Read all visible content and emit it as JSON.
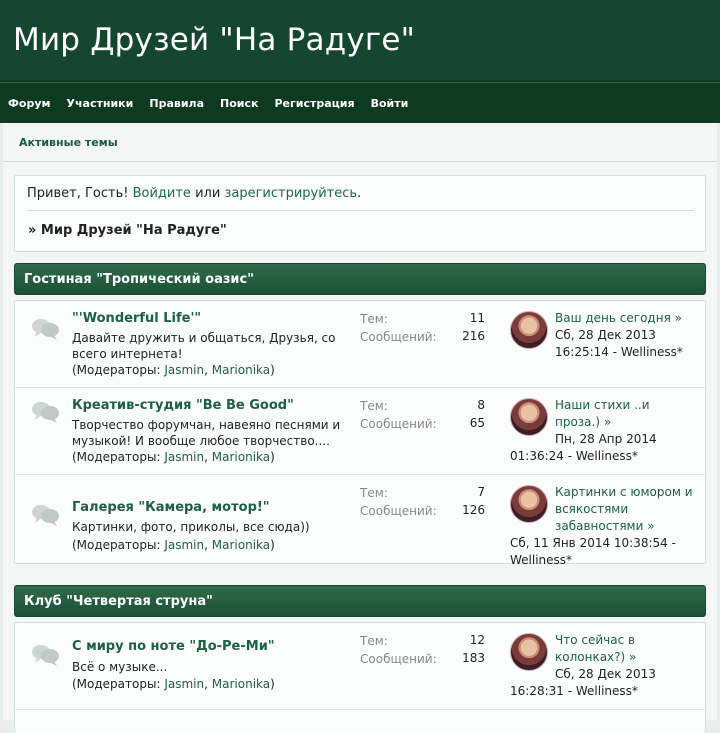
{
  "site": {
    "title": "Мир Друзей \"На Радуге\""
  },
  "menu": [
    "Форум",
    "Участники",
    "Правила",
    "Поиск",
    "Регистрация",
    "Войти"
  ],
  "subbar": {
    "active_topics": "Активные темы"
  },
  "userbox": {
    "greeting_prefix": "Привет, Гость!",
    "login_link": "Войдите",
    "or": "или",
    "register_link": "зарегистрируйтесь",
    "period": ".",
    "breadcrumb": "» Мир Друзей \"На Радуге\""
  },
  "labels": {
    "topics": "Тем:",
    "posts": "Сообщений:",
    "moderators_prefix": "(Модераторы:",
    "moderators_suffix": ")",
    "comma": ","
  },
  "categories": [
    {
      "name": "Гостиная \"Тропический оазис\"",
      "boards": [
        {
          "name": "\"'Wonderful Life'\"",
          "description": "Давайте дружить и общаться, Друзья, со всего интернета!",
          "moderators": [
            "Jasmin",
            "Marionika"
          ],
          "topics": "11",
          "posts": "216",
          "last_post_title": "Ваш день сегодня »",
          "last_post_date": "Сб, 28 Дек 2013",
          "last_post_time_author": "16:25:14 - Welliness*"
        },
        {
          "name": "Креатив-студия \"Be Be Good\"",
          "description": "Творчество форумчан, навеяно песнями и музыкой! И вообще любое творчество....",
          "moderators": [
            "Jasmin",
            "Marionika"
          ],
          "topics": "8",
          "posts": "65",
          "last_post_title": "Наши стихи ..и проза.) »",
          "last_post_date": "Пн, 28 Апр 2014",
          "last_post_time_author": "01:36:24 - Welliness*"
        },
        {
          "name": "Галерея \"Камера, мотор!\"",
          "description": "Картинки, фото, приколы, все сюда))",
          "moderators": [
            "Jasmin",
            "Marionika"
          ],
          "topics": "7",
          "posts": "126",
          "last_post_title": "Картинки с юмором и всякостями забавностями »",
          "last_post_date": "Сб, 11 Янв 2014 10:38:54 -",
          "last_post_time_author": "Welliness*"
        }
      ]
    },
    {
      "name": "Клуб \"Четвертая струна\"",
      "boards": [
        {
          "name": "С миру по ноте \"До-Ре-Ми\"",
          "description": "Всё о музыке...",
          "moderators": [
            "Jasmin",
            "Marionika"
          ],
          "topics": "12",
          "posts": "183",
          "last_post_title": "Что сейчас в колонках?) »",
          "last_post_date": "Сб, 28 Дек 2013",
          "last_post_time_author": "16:28:31 - Welliness*"
        }
      ]
    }
  ]
}
